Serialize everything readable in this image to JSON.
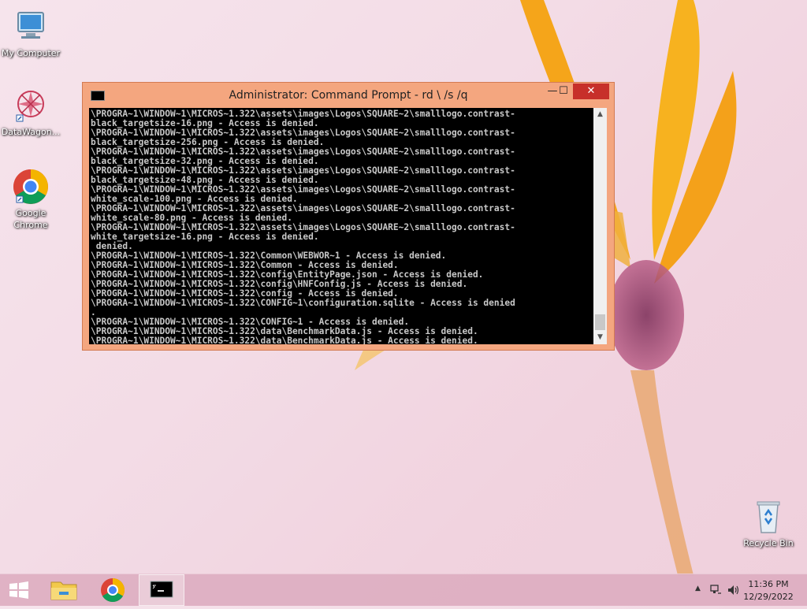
{
  "desktop": {
    "icons": [
      {
        "label": "My Computer"
      },
      {
        "label": "DataWagon..."
      },
      {
        "label": "Google Chrome"
      },
      {
        "label": "Recycle Bin"
      }
    ]
  },
  "window": {
    "title": "Administrator:  Command Prompt - rd \\ /s /q",
    "minimize": "—",
    "maximize": "☐",
    "close": "✕",
    "lines": [
      "\\PROGRA~1\\WINDOW~1\\MICROS~1.322\\assets\\images\\Logos\\SQUARE~2\\smalllogo.contrast-",
      "black_targetsize-16.png - Access is denied.",
      "\\PROGRA~1\\WINDOW~1\\MICROS~1.322\\assets\\images\\Logos\\SQUARE~2\\smalllogo.contrast-",
      "black_targetsize-256.png - Access is denied.",
      "\\PROGRA~1\\WINDOW~1\\MICROS~1.322\\assets\\images\\Logos\\SQUARE~2\\smalllogo.contrast-",
      "black_targetsize-32.png - Access is denied.",
      "\\PROGRA~1\\WINDOW~1\\MICROS~1.322\\assets\\images\\Logos\\SQUARE~2\\smalllogo.contrast-",
      "black_targetsize-48.png - Access is denied.",
      "\\PROGRA~1\\WINDOW~1\\MICROS~1.322\\assets\\images\\Logos\\SQUARE~2\\smalllogo.contrast-",
      "white_scale-100.png - Access is denied.",
      "\\PROGRA~1\\WINDOW~1\\MICROS~1.322\\assets\\images\\Logos\\SQUARE~2\\smalllogo.contrast-",
      "white_scale-80.png - Access is denied.",
      "\\PROGRA~1\\WINDOW~1\\MICROS~1.322\\assets\\images\\Logos\\SQUARE~2\\smalllogo.contrast-",
      "white_targetsize-16.png - Access is denied.",
      " denied.",
      "\\PROGRA~1\\WINDOW~1\\MICROS~1.322\\Common\\WEBWOR~1 - Access is denied.",
      "\\PROGRA~1\\WINDOW~1\\MICROS~1.322\\Common - Access is denied.",
      "\\PROGRA~1\\WINDOW~1\\MICROS~1.322\\config\\EntityPage.json - Access is denied.",
      "\\PROGRA~1\\WINDOW~1\\MICROS~1.322\\config\\HNFConfig.js - Access is denied.",
      "\\PROGRA~1\\WINDOW~1\\MICROS~1.322\\config - Access is denied.",
      "\\PROGRA~1\\WINDOW~1\\MICROS~1.322\\CONFIG~1\\configuration.sqlite - Access is denied",
      ".",
      "\\PROGRA~1\\WINDOW~1\\MICROS~1.322\\CONFIG~1 - Access is denied.",
      "\\PROGRA~1\\WINDOW~1\\MICROS~1.322\\data\\BenchmarkData.js - Access is denied.",
      "\\PROGRA~1\\WINDOW~1\\MICROS~1.322\\data\\BenchmarkData.js - Access is denied."
    ]
  },
  "taskbar": {
    "items": [
      {
        "icon": "windows-start-icon"
      },
      {
        "icon": "file-explorer-icon"
      },
      {
        "icon": "chrome-icon"
      },
      {
        "icon": "command-prompt-icon"
      }
    ],
    "time": "11:36 PM",
    "date": "12/29/2022"
  },
  "colors": {
    "titlebar": "#f4a67f",
    "close_button": "#c7302a",
    "console_bg": "#000000",
    "console_text": "#c8c8c8"
  }
}
